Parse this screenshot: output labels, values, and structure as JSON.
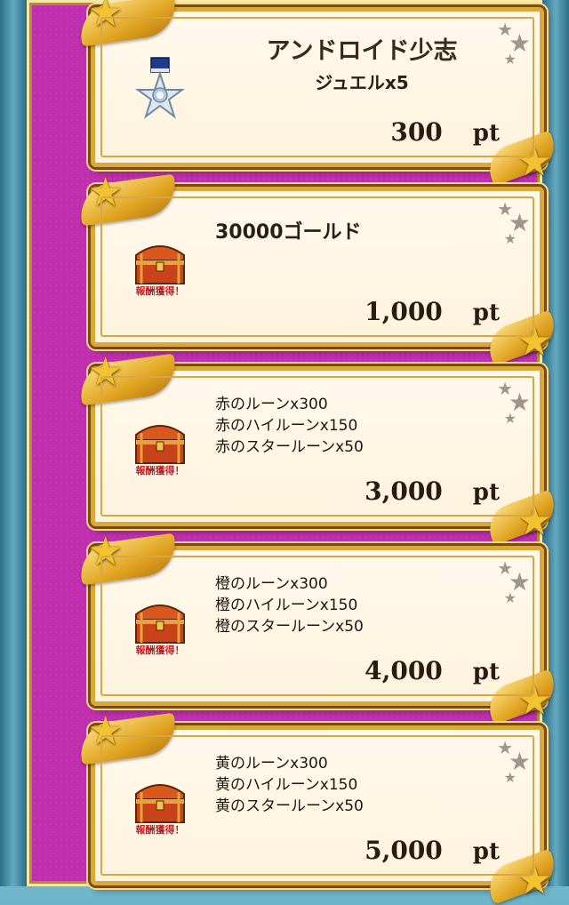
{
  "rewards": [
    {
      "icon": "medal-icon",
      "title": "アンドロイド少志",
      "subtitle": "ジュエルx5",
      "points": "300",
      "unit": "pt"
    },
    {
      "icon": "treasure-chest-icon",
      "chest_label": "報酬獲得！",
      "title": "30000ゴールド",
      "points": "1,000",
      "unit": "pt"
    },
    {
      "icon": "treasure-chest-icon",
      "chest_label": "報酬獲得！",
      "lines": [
        "赤のルーンx300",
        "赤のハイルーンx150",
        "赤のスタールーンx50"
      ],
      "points": "3,000",
      "unit": "pt"
    },
    {
      "icon": "treasure-chest-icon",
      "chest_label": "報酬獲得！",
      "lines": [
        "橙のルーンx300",
        "橙のハイルーンx150",
        "橙のスタールーンx50"
      ],
      "points": "4,000",
      "unit": "pt"
    },
    {
      "icon": "treasure-chest-icon",
      "chest_label": "報酬獲得！",
      "lines": [
        "黄のルーンx300",
        "黄のハイルーンx150",
        "黄のスタールーンx50"
      ],
      "points": "5,000",
      "unit": "pt"
    }
  ],
  "colors": {
    "panel": "#c02fae",
    "gold": "#d9a93a",
    "card": "#fff6e4"
  }
}
